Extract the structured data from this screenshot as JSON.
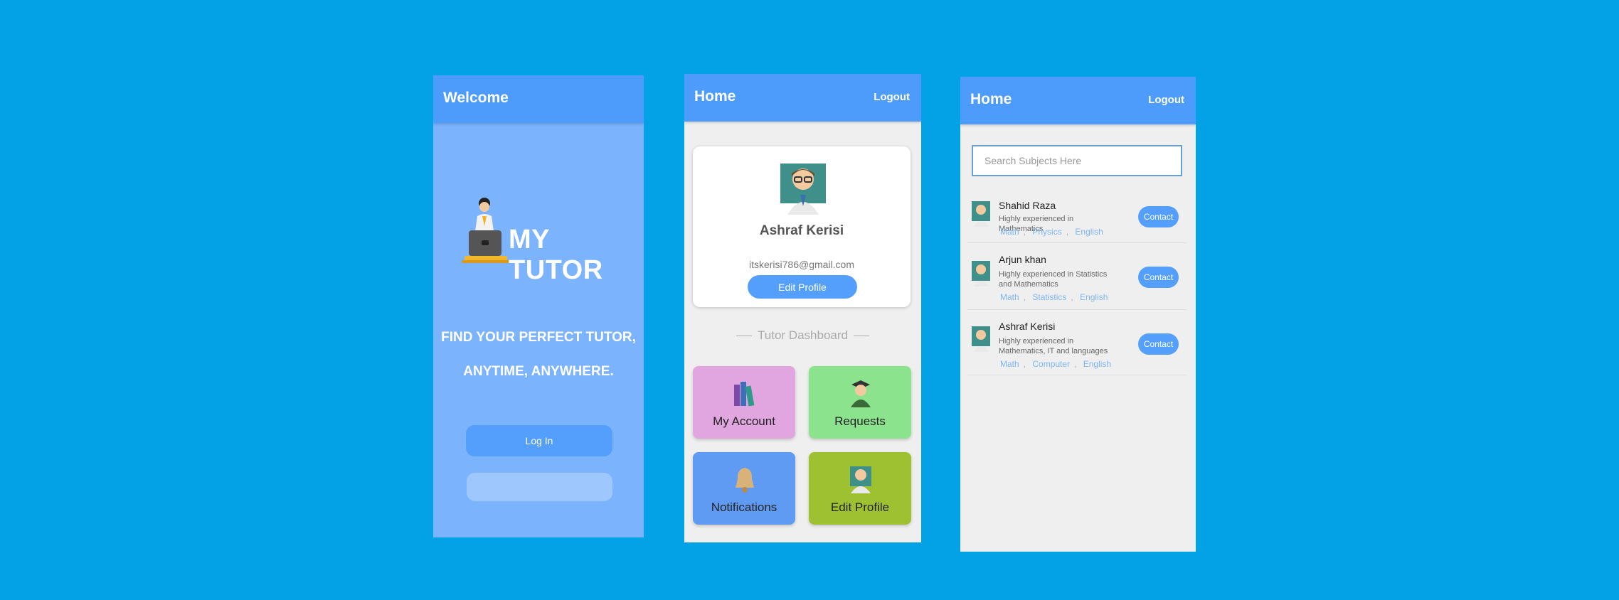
{
  "welcome_screen": {
    "appbar_title": "Welcome",
    "brand": "MY TUTOR",
    "tagline_line1": "FIND YOUR PERFECT TUTOR,",
    "tagline_line2": "ANYTIME, ANYWHERE.",
    "login_label": "Log In"
  },
  "home_screen": {
    "appbar_title": "Home",
    "logout_label": "Logout",
    "profile": {
      "name": "Ashraf Kerisi",
      "email": "itskerisi786@gmail.com",
      "edit_label": "Edit Profile"
    },
    "dashboard_title": "Tutor Dashboard",
    "tiles": [
      {
        "label": "My Account",
        "icon": "books-icon",
        "color": "#e1a6df"
      },
      {
        "label": "Requests",
        "icon": "graduate-icon",
        "color": "#8ce38e"
      },
      {
        "label": "Notifications",
        "icon": "bell-icon",
        "color": "#5f9bf3"
      },
      {
        "label": "Edit Profile",
        "icon": "teacher-icon",
        "color": "#9ec131"
      }
    ]
  },
  "search_screen": {
    "appbar_title": "Home",
    "logout_label": "Logout",
    "search_placeholder": "Search Subjects Here",
    "tutors": [
      {
        "name": "Shahid Raza",
        "description": "Highly experienced in Mathematics",
        "subjects": [
          "Math",
          "Physics",
          "English"
        ],
        "contact_label": "Contact"
      },
      {
        "name": "Arjun khan",
        "description": "Highly experienced in Statistics and Mathematics",
        "subjects": [
          "Math",
          "Statistics",
          "English"
        ],
        "contact_label": "Contact"
      },
      {
        "name": "Ashraf Kerisi",
        "description": "Highly experienced in Mathematics, IT and languages",
        "subjects": [
          "Math",
          "Computer",
          "English"
        ],
        "contact_label": "Contact"
      }
    ]
  },
  "colors": {
    "background": "#03a2e6",
    "appbar": "#4d9bfa",
    "primary_button": "#559ffc"
  }
}
